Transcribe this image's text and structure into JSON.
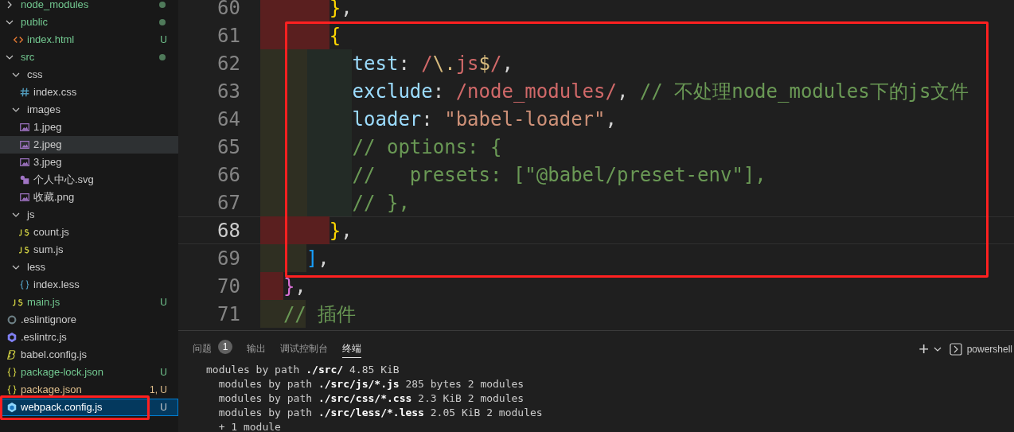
{
  "explorer": {
    "items": [
      {
        "label": "node_modules",
        "kind": "folder",
        "expanded": false,
        "dot": true,
        "color": "#73c991",
        "selected": false,
        "hovered": false
      },
      {
        "label": "public",
        "kind": "folder",
        "expanded": true,
        "dot": true,
        "color": "#73c991",
        "selected": false,
        "hovered": false,
        "children": [
          {
            "label": "index.html",
            "kind": "html",
            "git": "U",
            "color": "#73c991",
            "selected": false,
            "hovered": false
          }
        ]
      },
      {
        "label": "src",
        "kind": "folder",
        "expanded": true,
        "dot": true,
        "color": "#73c991",
        "selected": false,
        "hovered": false,
        "children": [
          {
            "label": "css",
            "kind": "folder",
            "expanded": true,
            "color": "#cccccc",
            "selected": false,
            "hovered": false,
            "children": [
              {
                "label": "index.css",
                "kind": "css",
                "color": "#cccccc",
                "selected": false,
                "hovered": false
              }
            ]
          },
          {
            "label": "images",
            "kind": "folder",
            "expanded": true,
            "color": "#cccccc",
            "selected": false,
            "hovered": false,
            "children": [
              {
                "label": "1.jpeg",
                "kind": "image",
                "color": "#cccccc",
                "selected": false,
                "hovered": false
              },
              {
                "label": "2.jpeg",
                "kind": "image",
                "color": "#cccccc",
                "selected": false,
                "hovered": true
              },
              {
                "label": "3.jpeg",
                "kind": "image",
                "color": "#cccccc",
                "selected": false,
                "hovered": false
              },
              {
                "label": "个人中心.svg",
                "kind": "svg",
                "color": "#cccccc",
                "selected": false,
                "hovered": false
              },
              {
                "label": "收藏.png",
                "kind": "image",
                "color": "#cccccc",
                "selected": false,
                "hovered": false
              }
            ]
          },
          {
            "label": "js",
            "kind": "folder",
            "expanded": true,
            "color": "#cccccc",
            "selected": false,
            "hovered": false,
            "children": [
              {
                "label": "count.js",
                "kind": "js",
                "color": "#cccccc",
                "selected": false,
                "hovered": false
              },
              {
                "label": "sum.js",
                "kind": "js",
                "color": "#cccccc",
                "selected": false,
                "hovered": false
              }
            ]
          },
          {
            "label": "less",
            "kind": "folder",
            "expanded": true,
            "color": "#cccccc",
            "selected": false,
            "hovered": false,
            "children": [
              {
                "label": "index.less",
                "kind": "braces",
                "color": "#cccccc",
                "selected": false,
                "hovered": false
              }
            ]
          },
          {
            "label": "main.js",
            "kind": "js",
            "git": "U",
            "color": "#73c991",
            "selected": false,
            "hovered": false
          }
        ]
      },
      {
        "label": ".eslintignore",
        "kind": "ignore",
        "color": "#cccccc",
        "selected": false,
        "hovered": false
      },
      {
        "label": ".eslintrc.js",
        "kind": "eslint",
        "color": "#cccccc",
        "selected": false,
        "hovered": false
      },
      {
        "label": "babel.config.js",
        "kind": "babel",
        "color": "#cccccc",
        "selected": false,
        "hovered": false
      },
      {
        "label": "package-lock.json",
        "kind": "json",
        "git": "U",
        "color": "#73c991",
        "selected": false,
        "hovered": false
      },
      {
        "label": "package.json",
        "kind": "json",
        "git": "1, U",
        "color": "#e2c08d",
        "selected": false,
        "hovered": false
      },
      {
        "label": "webpack.config.js",
        "kind": "webpack",
        "git": "U",
        "selected": true,
        "marked": true
      }
    ]
  },
  "editor": {
    "marked": true,
    "lines": [
      {
        "number": "60",
        "current": false,
        "bands": [
          {
            "color": "#5a1f1f"
          }
        ],
        "tokens": [
          {
            "kind": "brace1",
            "text": "      }"
          },
          {
            "kind": "punct",
            "text": ","
          }
        ]
      },
      {
        "number": "61",
        "current": false,
        "bands": [
          {
            "color": "#5a1f1f"
          }
        ],
        "tokens": [
          {
            "kind": "brace1",
            "text": "      {"
          }
        ]
      },
      {
        "number": "62",
        "current": false,
        "bands": [
          {
            "color": "#2f2f22"
          },
          {
            "color": "#232b26"
          }
        ],
        "tokens": [
          {
            "kind": "key",
            "text": "        test"
          },
          {
            "kind": "punct",
            "text": ": "
          },
          {
            "kind": "regex",
            "text": "/"
          },
          {
            "kind": "escape",
            "text": "\\."
          },
          {
            "kind": "regex",
            "text": "js"
          },
          {
            "kind": "escape",
            "text": "$"
          },
          {
            "kind": "regex",
            "text": "/"
          },
          {
            "kind": "punct",
            "text": ","
          }
        ]
      },
      {
        "number": "63",
        "current": false,
        "bands": [
          {
            "color": "#2f2f22"
          },
          {
            "color": "#232b26"
          }
        ],
        "tokens": [
          {
            "kind": "key",
            "text": "        exclude"
          },
          {
            "kind": "punct",
            "text": ": "
          },
          {
            "kind": "regex",
            "text": "/node_modules/"
          },
          {
            "kind": "punct",
            "text": ", "
          },
          {
            "kind": "comment",
            "text": "// 不处理node_modules下的js文件"
          }
        ]
      },
      {
        "number": "64",
        "current": false,
        "bands": [
          {
            "color": "#2f2f22"
          },
          {
            "color": "#232b26"
          }
        ],
        "tokens": [
          {
            "kind": "key",
            "text": "        loader"
          },
          {
            "kind": "punct",
            "text": ": "
          },
          {
            "kind": "string",
            "text": "\"babel-loader\""
          },
          {
            "kind": "punct",
            "text": ","
          }
        ]
      },
      {
        "number": "65",
        "current": false,
        "bands": [
          {
            "color": "#2f2f22"
          },
          {
            "color": "#232b26"
          }
        ],
        "tokens": [
          {
            "kind": "comment",
            "text": "        // options: {"
          }
        ]
      },
      {
        "number": "66",
        "current": false,
        "bands": [
          {
            "color": "#2f2f22"
          },
          {
            "color": "#232b26"
          }
        ],
        "tokens": [
          {
            "kind": "comment",
            "text": "        //   presets: [\"@babel/preset-env\"],"
          }
        ]
      },
      {
        "number": "67",
        "current": false,
        "bands": [
          {
            "color": "#2f2f22"
          },
          {
            "color": "#232b26"
          }
        ],
        "tokens": [
          {
            "kind": "comment",
            "text": "        // },"
          }
        ]
      },
      {
        "number": "68",
        "current": true,
        "bands": [
          {
            "color": "#5a1f1f"
          }
        ],
        "tokens": [
          {
            "kind": "brace1",
            "text": "      }"
          },
          {
            "kind": "punct",
            "text": ","
          }
        ]
      },
      {
        "number": "69",
        "current": false,
        "bands": [
          {
            "color": "#2f2f22"
          }
        ],
        "tokens": [
          {
            "kind": "brace2",
            "text": "    ]"
          },
          {
            "kind": "punct",
            "text": ","
          }
        ]
      },
      {
        "number": "70",
        "current": false,
        "bands": [
          {
            "color": "#5a1f1f"
          }
        ],
        "tokens": [
          {
            "kind": "brace3",
            "text": "  }"
          },
          {
            "kind": "punct",
            "text": ","
          }
        ]
      },
      {
        "number": "71",
        "current": false,
        "bands": [
          {
            "color": "#2f2f22"
          }
        ],
        "tokens": [
          {
            "kind": "comment",
            "text": "  // 插件"
          }
        ]
      }
    ]
  },
  "panel": {
    "tabs": [
      {
        "label": "问题",
        "badge": "1",
        "selected": false
      },
      {
        "label": "输出",
        "selected": false
      },
      {
        "label": "调试控制台",
        "selected": false
      },
      {
        "label": "终端",
        "selected": true
      }
    ],
    "actions": {
      "new": "+",
      "shell": "powershell"
    },
    "terminal": [
      "modules by path **./src/** 4.85 KiB",
      "  modules by path **./src/js/*.js** 285 bytes 2 modules",
      "  modules by path **./src/css/*.css** 2.3 KiB 2 modules",
      "  modules by path **./src/less/*.less** 2.05 KiB 2 modules",
      "  + 1 module"
    ]
  }
}
